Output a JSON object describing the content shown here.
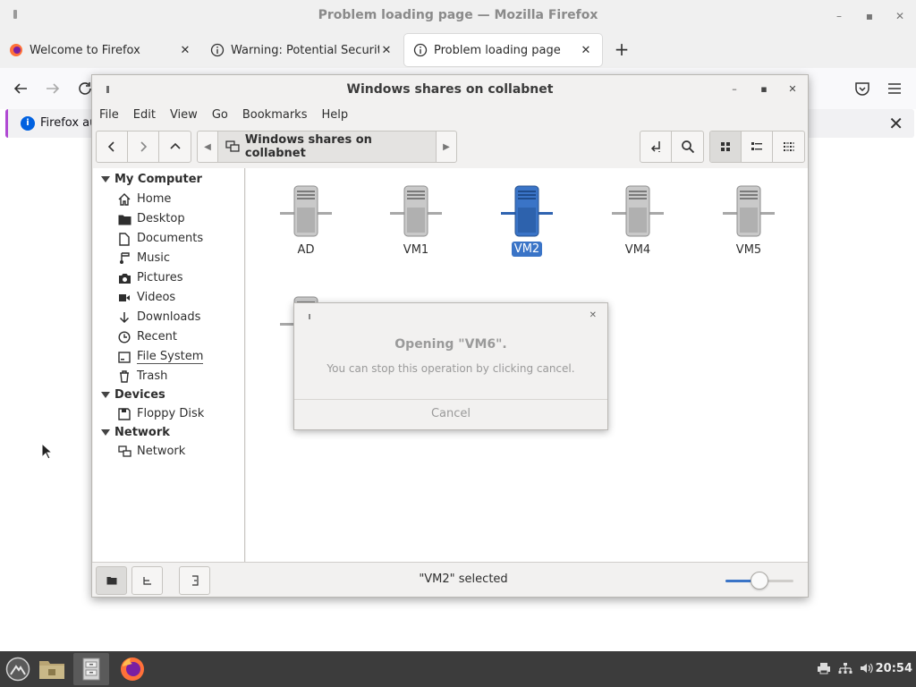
{
  "firefox": {
    "window_title": "Problem loading page — Mozilla Firefox",
    "tabs": [
      {
        "label": "Welcome to Firefox",
        "icon": "firefox-logo-icon"
      },
      {
        "label": "Warning: Potential Security",
        "icon": "info-icon"
      },
      {
        "label": "Problem loading page",
        "icon": "info-icon",
        "active": true
      }
    ],
    "new_tab_label": "+",
    "notification_text": "Firefox au"
  },
  "caja": {
    "window_title": "Windows shares on collabnet",
    "menu": [
      "File",
      "Edit",
      "View",
      "Go",
      "Bookmarks",
      "Help"
    ],
    "path_crumb": "Windows shares on collabnet",
    "sidebar": {
      "sections": [
        {
          "title": "My Computer",
          "items": [
            "Home",
            "Desktop",
            "Documents",
            "Music",
            "Pictures",
            "Videos",
            "Downloads",
            "Recent",
            "File System",
            "Trash"
          ]
        },
        {
          "title": "Devices",
          "items": [
            "Floppy Disk"
          ]
        },
        {
          "title": "Network",
          "items": [
            "Network"
          ]
        }
      ]
    },
    "files": [
      {
        "name": "AD",
        "selected": false
      },
      {
        "name": "VM1",
        "selected": false
      },
      {
        "name": "VM2",
        "selected": true
      },
      {
        "name": "VM4",
        "selected": false
      },
      {
        "name": "VM5",
        "selected": false
      }
    ],
    "status_text": "\"VM2\" selected",
    "zoom_level_fraction": 0.5
  },
  "dialog": {
    "title": "Opening \"VM6\".",
    "message": "You can stop this operation by clicking cancel.",
    "cancel_label": "Cancel"
  },
  "taskbar": {
    "clock": "20:54"
  },
  "colors": {
    "selection": "#3a74c7",
    "taskbar": "#3c3c3c",
    "notification_accent": "#b04ad3"
  }
}
